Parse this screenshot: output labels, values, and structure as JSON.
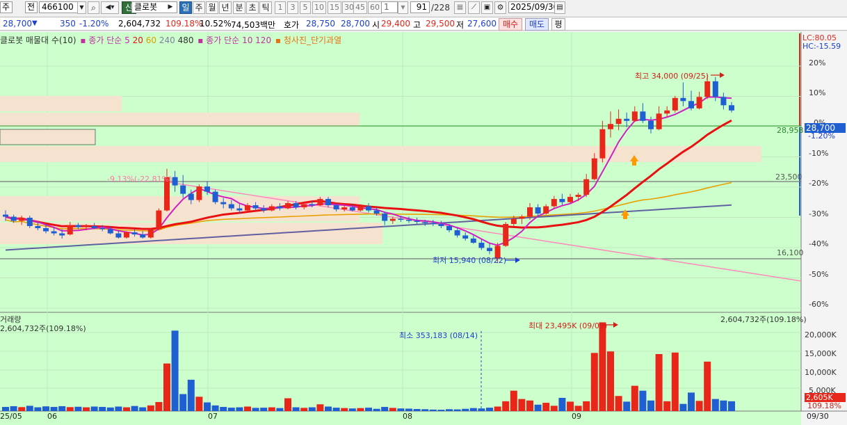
{
  "toolbar": {
    "type1": "주",
    "type2": "전",
    "code": "466100",
    "tag": "신",
    "name": "클로봇",
    "periods": [
      "일",
      "주",
      "월",
      "년",
      "분",
      "초",
      "틱"
    ],
    "selected_period": "일",
    "minute_steps": [
      "1",
      "3",
      "5",
      "10",
      "15",
      "30",
      "45",
      "60"
    ],
    "count_value": "1",
    "page": "91",
    "page_total": "/228",
    "date": "2025/09/30"
  },
  "quote": {
    "price": "28,700",
    "direction": "▼",
    "change": "350",
    "change_pct": "-1.20%",
    "volume": "2,604,732",
    "volume_ratio": "109.18%",
    "turnover": "10.52%",
    "amount": "74,503백만",
    "bid_label": "호가",
    "bid": "28,750",
    "ask": "28,700",
    "open_label": "시",
    "open": "29,400",
    "high_label": "고",
    "high": "29,500",
    "low_label": "저",
    "low": "27,600",
    "buy_label": "매수",
    "sell_label": "매도",
    "eval_label": "평"
  },
  "legend": {
    "title": "클로봇 매물대 수(10)",
    "ma_price_label": "종가 단순",
    "ma_price_periods": [
      "5",
      "20",
      "60",
      "240",
      "480"
    ],
    "ma_vol_label": "종가 단순",
    "ma_vol_periods": [
      "10",
      "120"
    ],
    "signal": "청사진_단기과열"
  },
  "price_panel": {
    "lc": "LC:80.05",
    "hc": "HC:-15.59",
    "pct_ticks": [
      "20%",
      "10%",
      "0%",
      "-10%",
      "-20%",
      "-30%",
      "-40%",
      "-50%",
      "-60%"
    ],
    "current_price": "28,700",
    "current_pct": "-1.20%",
    "level_1": "28,958",
    "level_2": "23,500",
    "level_3": "16,100",
    "annot_high": "최고 34,000 (09/25)",
    "annot_low": "최저 15,940 (08/22)",
    "annot_trend": "-9.13%(-22.81%)"
  },
  "volume_panel": {
    "title": "거래량",
    "left_value": "2,604,732주(109.18%)",
    "right_value": "2,604,732주(109.18%)",
    "annot_max": "최대 23,495K (09/09)",
    "annot_min": "최소 353,183 (08/14)",
    "ticks": [
      "20,000K",
      "15,000K",
      "10,000K",
      "5,000K"
    ],
    "current_value": "2,605K",
    "current_pct": "109.18%"
  },
  "dates": [
    "25/05",
    "06",
    "07",
    "08",
    "09",
    "09/30"
  ],
  "colors": {
    "up": "#e8261a",
    "down": "#1f5fd1",
    "bg": "#ccffcc",
    "ma5": "#d020c0",
    "ma20": "#e81010",
    "ma60": "#e8a000",
    "ma240": "#6060a0",
    "trend": "#ff88bb"
  },
  "chart_data": {
    "type": "candlestick",
    "candles": [
      {
        "o": 20600,
        "h": 21000,
        "l": 20000,
        "c": 20400
      },
      {
        "o": 20400,
        "h": 20600,
        "l": 19800,
        "c": 20000
      },
      {
        "o": 20000,
        "h": 20500,
        "l": 19600,
        "c": 20300
      },
      {
        "o": 20300,
        "h": 20500,
        "l": 19300,
        "c": 19500
      },
      {
        "o": 19500,
        "h": 19900,
        "l": 19100,
        "c": 19300
      },
      {
        "o": 19300,
        "h": 19700,
        "l": 18800,
        "c": 19000
      },
      {
        "o": 19000,
        "h": 19400,
        "l": 18600,
        "c": 18800
      },
      {
        "o": 18800,
        "h": 19200,
        "l": 18300,
        "c": 18600
      },
      {
        "o": 18700,
        "h": 19900,
        "l": 18600,
        "c": 19600
      },
      {
        "o": 19600,
        "h": 19800,
        "l": 19200,
        "c": 19400
      },
      {
        "o": 19400,
        "h": 19700,
        "l": 19100,
        "c": 19500
      },
      {
        "o": 19500,
        "h": 19800,
        "l": 19200,
        "c": 19300
      },
      {
        "o": 19300,
        "h": 19600,
        "l": 19000,
        "c": 19200
      },
      {
        "o": 19200,
        "h": 19500,
        "l": 18700,
        "c": 18800
      },
      {
        "o": 18800,
        "h": 19100,
        "l": 18300,
        "c": 18400
      },
      {
        "o": 18400,
        "h": 19000,
        "l": 18300,
        "c": 18900
      },
      {
        "o": 18900,
        "h": 19200,
        "l": 18500,
        "c": 18700
      },
      {
        "o": 18700,
        "h": 19000,
        "l": 18300,
        "c": 18400
      },
      {
        "o": 18400,
        "h": 19300,
        "l": 18300,
        "c": 19200
      },
      {
        "o": 19200,
        "h": 21200,
        "l": 19100,
        "c": 21000
      },
      {
        "o": 21000,
        "h": 25000,
        "l": 20900,
        "c": 24200
      },
      {
        "o": 24200,
        "h": 24800,
        "l": 22800,
        "c": 23400
      },
      {
        "o": 23400,
        "h": 24400,
        "l": 22200,
        "c": 22600
      },
      {
        "o": 22600,
        "h": 23000,
        "l": 21600,
        "c": 22000
      },
      {
        "o": 22000,
        "h": 23500,
        "l": 21800,
        "c": 23300
      },
      {
        "o": 23300,
        "h": 23800,
        "l": 22500,
        "c": 22800
      },
      {
        "o": 22800,
        "h": 23000,
        "l": 21600,
        "c": 21800
      },
      {
        "o": 21800,
        "h": 22200,
        "l": 21200,
        "c": 21600
      },
      {
        "o": 21600,
        "h": 22000,
        "l": 21000,
        "c": 21200
      },
      {
        "o": 21200,
        "h": 21600,
        "l": 20700,
        "c": 21000
      },
      {
        "o": 21000,
        "h": 21700,
        "l": 20900,
        "c": 21500
      },
      {
        "o": 21500,
        "h": 21800,
        "l": 21000,
        "c": 21200
      },
      {
        "o": 21200,
        "h": 21500,
        "l": 20800,
        "c": 21000
      },
      {
        "o": 21000,
        "h": 21600,
        "l": 20900,
        "c": 21400
      },
      {
        "o": 21400,
        "h": 21700,
        "l": 21000,
        "c": 21200
      },
      {
        "o": 21200,
        "h": 21900,
        "l": 21100,
        "c": 21700
      },
      {
        "o": 21700,
        "h": 21900,
        "l": 21100,
        "c": 21300
      },
      {
        "o": 21300,
        "h": 21800,
        "l": 21100,
        "c": 21600
      },
      {
        "o": 21600,
        "h": 21900,
        "l": 21300,
        "c": 21500
      },
      {
        "o": 21500,
        "h": 22300,
        "l": 21400,
        "c": 22100
      },
      {
        "o": 22100,
        "h": 22300,
        "l": 21300,
        "c": 21500
      },
      {
        "o": 21500,
        "h": 21700,
        "l": 20900,
        "c": 21100
      },
      {
        "o": 21100,
        "h": 21500,
        "l": 20900,
        "c": 21300
      },
      {
        "o": 21300,
        "h": 21600,
        "l": 20900,
        "c": 21000
      },
      {
        "o": 21000,
        "h": 21600,
        "l": 20900,
        "c": 21400
      },
      {
        "o": 21400,
        "h": 21700,
        "l": 20800,
        "c": 21000
      },
      {
        "o": 21000,
        "h": 21300,
        "l": 20500,
        "c": 20700
      },
      {
        "o": 20700,
        "h": 20900,
        "l": 19600,
        "c": 20000
      },
      {
        "o": 20000,
        "h": 20400,
        "l": 19700,
        "c": 20200
      },
      {
        "o": 20200,
        "h": 20500,
        "l": 19900,
        "c": 20100
      },
      {
        "o": 20100,
        "h": 20400,
        "l": 19800,
        "c": 20000
      },
      {
        "o": 20000,
        "h": 20300,
        "l": 19700,
        "c": 19900
      },
      {
        "o": 19900,
        "h": 20100,
        "l": 19500,
        "c": 19800
      },
      {
        "o": 19800,
        "h": 20100,
        "l": 19500,
        "c": 19700
      },
      {
        "o": 19700,
        "h": 20000,
        "l": 19300,
        "c": 19500
      },
      {
        "o": 19500,
        "h": 19700,
        "l": 18900,
        "c": 19100
      },
      {
        "o": 19100,
        "h": 19300,
        "l": 18400,
        "c": 18600
      },
      {
        "o": 18600,
        "h": 18900,
        "l": 18100,
        "c": 18300
      },
      {
        "o": 18300,
        "h": 18600,
        "l": 17800,
        "c": 17900
      },
      {
        "o": 17900,
        "h": 18200,
        "l": 17200,
        "c": 17400
      },
      {
        "o": 17400,
        "h": 17800,
        "l": 16800,
        "c": 17100
      },
      {
        "o": 16400,
        "h": 17900,
        "l": 15940,
        "c": 17600
      },
      {
        "o": 17600,
        "h": 19900,
        "l": 17500,
        "c": 19700
      },
      {
        "o": 19700,
        "h": 20500,
        "l": 19400,
        "c": 20200
      },
      {
        "o": 20200,
        "h": 20600,
        "l": 19700,
        "c": 20400
      },
      {
        "o": 20400,
        "h": 21700,
        "l": 20100,
        "c": 21300
      },
      {
        "o": 21300,
        "h": 21600,
        "l": 20400,
        "c": 20700
      },
      {
        "o": 20700,
        "h": 21600,
        "l": 20600,
        "c": 21400
      },
      {
        "o": 21400,
        "h": 22400,
        "l": 21200,
        "c": 22100
      },
      {
        "o": 22100,
        "h": 22600,
        "l": 21500,
        "c": 21800
      },
      {
        "o": 21800,
        "h": 22600,
        "l": 21700,
        "c": 22300
      },
      {
        "o": 22300,
        "h": 22700,
        "l": 21900,
        "c": 22500
      },
      {
        "o": 22500,
        "h": 24500,
        "l": 22300,
        "c": 24000
      },
      {
        "o": 24000,
        "h": 26500,
        "l": 23900,
        "c": 26000
      },
      {
        "o": 26000,
        "h": 29600,
        "l": 25600,
        "c": 28800
      },
      {
        "o": 28800,
        "h": 30500,
        "l": 28000,
        "c": 29300
      },
      {
        "o": 29300,
        "h": 30700,
        "l": 28700,
        "c": 29800
      },
      {
        "o": 29800,
        "h": 30400,
        "l": 29000,
        "c": 29600
      },
      {
        "o": 29600,
        "h": 31000,
        "l": 29500,
        "c": 30500
      },
      {
        "o": 30500,
        "h": 31300,
        "l": 29400,
        "c": 29600
      },
      {
        "o": 29600,
        "h": 30000,
        "l": 28400,
        "c": 28800
      },
      {
        "o": 28800,
        "h": 31000,
        "l": 28700,
        "c": 30300
      },
      {
        "o": 30300,
        "h": 31000,
        "l": 30000,
        "c": 30600
      },
      {
        "o": 30600,
        "h": 32000,
        "l": 30400,
        "c": 31800
      },
      {
        "o": 31800,
        "h": 33300,
        "l": 31000,
        "c": 31500
      },
      {
        "o": 31500,
        "h": 32500,
        "l": 30600,
        "c": 30800
      },
      {
        "o": 30800,
        "h": 32400,
        "l": 30700,
        "c": 31900
      },
      {
        "o": 31900,
        "h": 34000,
        "l": 31700,
        "c": 33400
      },
      {
        "o": 33400,
        "h": 33800,
        "l": 31500,
        "c": 31900
      },
      {
        "o": 31900,
        "h": 32300,
        "l": 30700,
        "c": 31100
      },
      {
        "o": 31100,
        "h": 31400,
        "l": 30400,
        "c": 30600
      }
    ],
    "volume_k": [
      1100,
      1300,
      1050,
      1400,
      1000,
      1250,
      1100,
      1300,
      1050,
      1150,
      1000,
      1200,
      1100,
      950,
      1200,
      1000,
      1350,
      1000,
      1500,
      2400,
      12600,
      21300,
      4500,
      8300,
      3800,
      2300,
      1500,
      1100,
      900,
      1000,
      1200,
      850,
      900,
      1000,
      800,
      3400,
      1000,
      850,
      1000,
      1800,
      1200,
      900,
      800,
      700,
      800,
      900,
      600,
      1100,
      850,
      700,
      650,
      550,
      500,
      400,
      353,
      500,
      450,
      600,
      800,
      700,
      900,
      1200,
      2600,
      5400,
      3200,
      2800,
      1700,
      2200,
      1400,
      3500,
      2500,
      1400,
      2600,
      15400,
      23495,
      15800,
      4000,
      2500,
      6700,
      5400,
      2800,
      15100,
      2600,
      15500,
      1900,
      4900,
      2700,
      13100,
      3200,
      2800,
      2605
    ],
    "ylim": [
      15940,
      34000
    ]
  }
}
